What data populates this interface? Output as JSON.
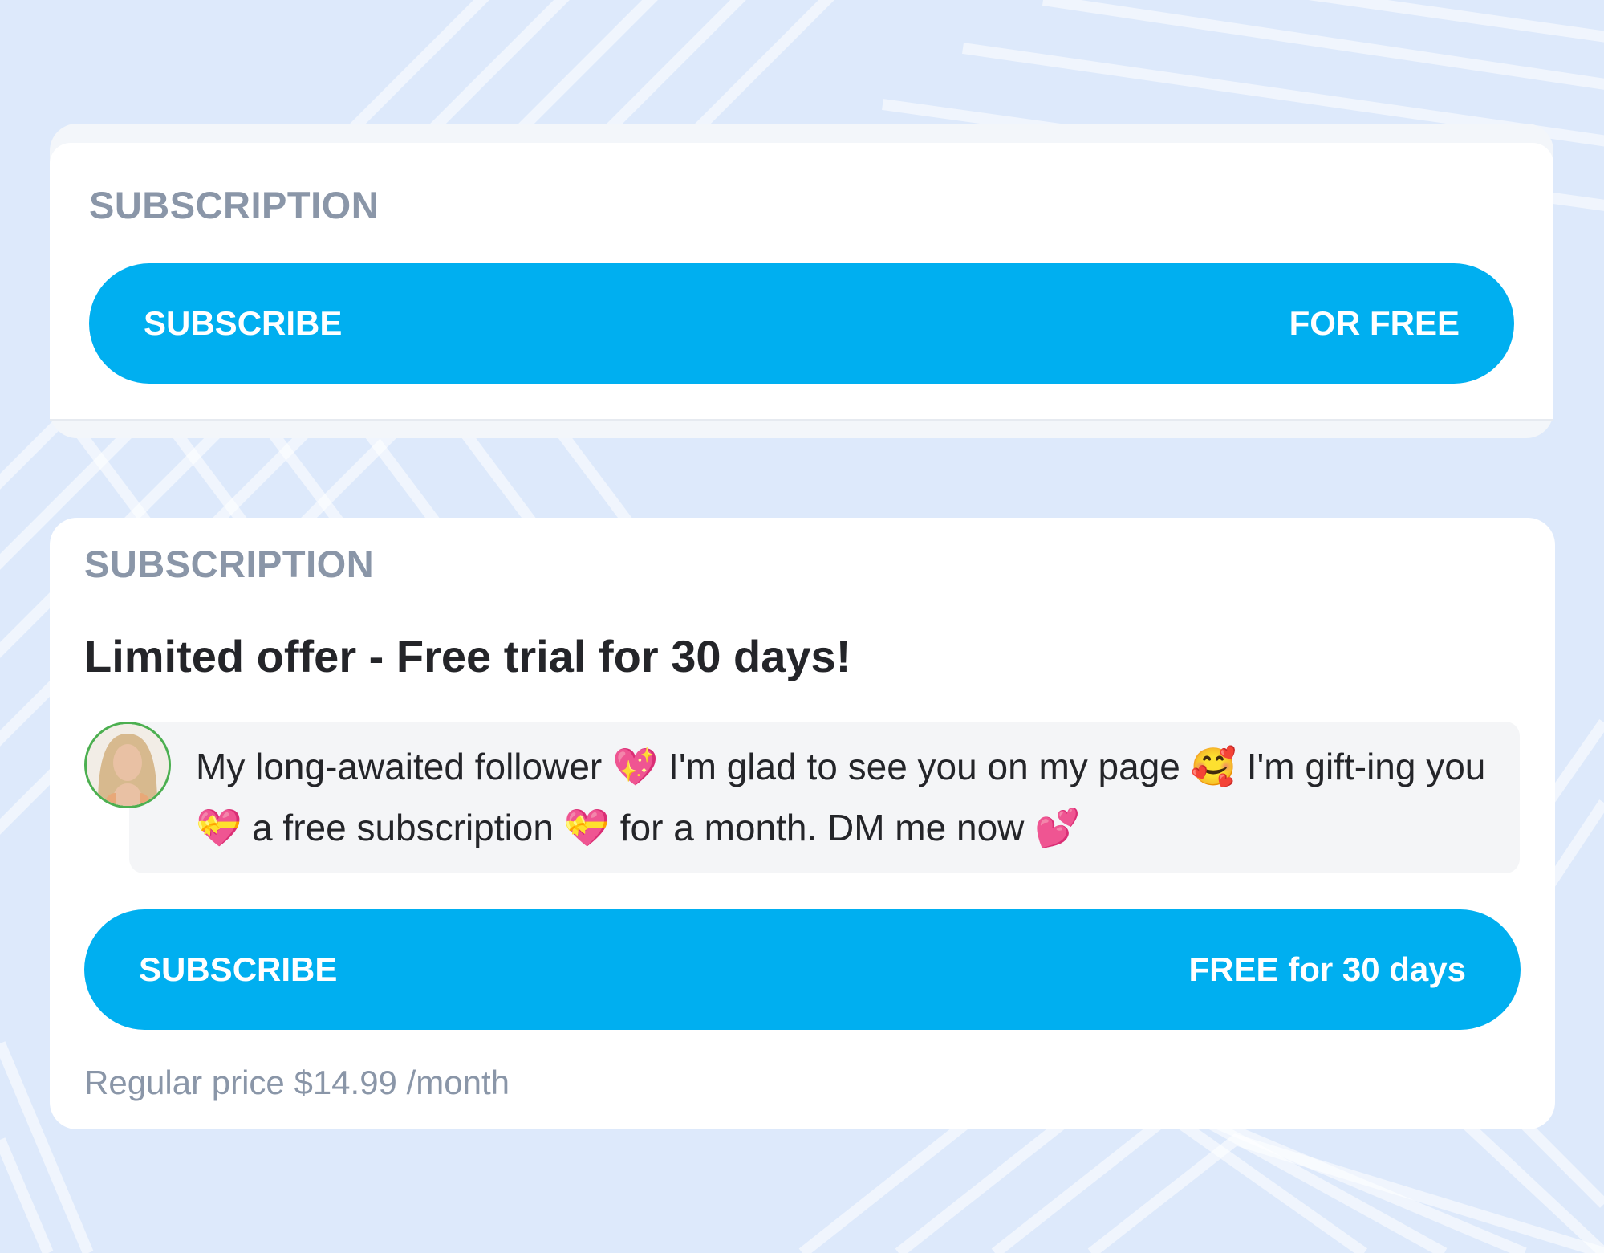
{
  "colors": {
    "background": "#dde9fb",
    "card": "#ffffff",
    "accent": "#00aff0",
    "label": "#8a96a8",
    "text": "#242529",
    "bubble": "#f4f5f7",
    "avatar_ring": "#4caf50"
  },
  "card_basic": {
    "section_label": "SUBSCRIPTION",
    "button": {
      "label": "SUBSCRIBE",
      "price": "FOR FREE"
    }
  },
  "card_offer": {
    "section_label": "SUBSCRIPTION",
    "title": "Limited offer - Free trial for 30 days!",
    "avatar_icon": "creator-avatar",
    "message": "My long-awaited follower 💖 I'm glad to see you on my page 🥰 I'm gift-ing you 💝 a free subscription 💝 for a month. DM me now 💕",
    "button": {
      "label": "SUBSCRIBE",
      "price": "FREE for 30 days"
    },
    "regular_price": "Regular price $14.99 /month"
  }
}
